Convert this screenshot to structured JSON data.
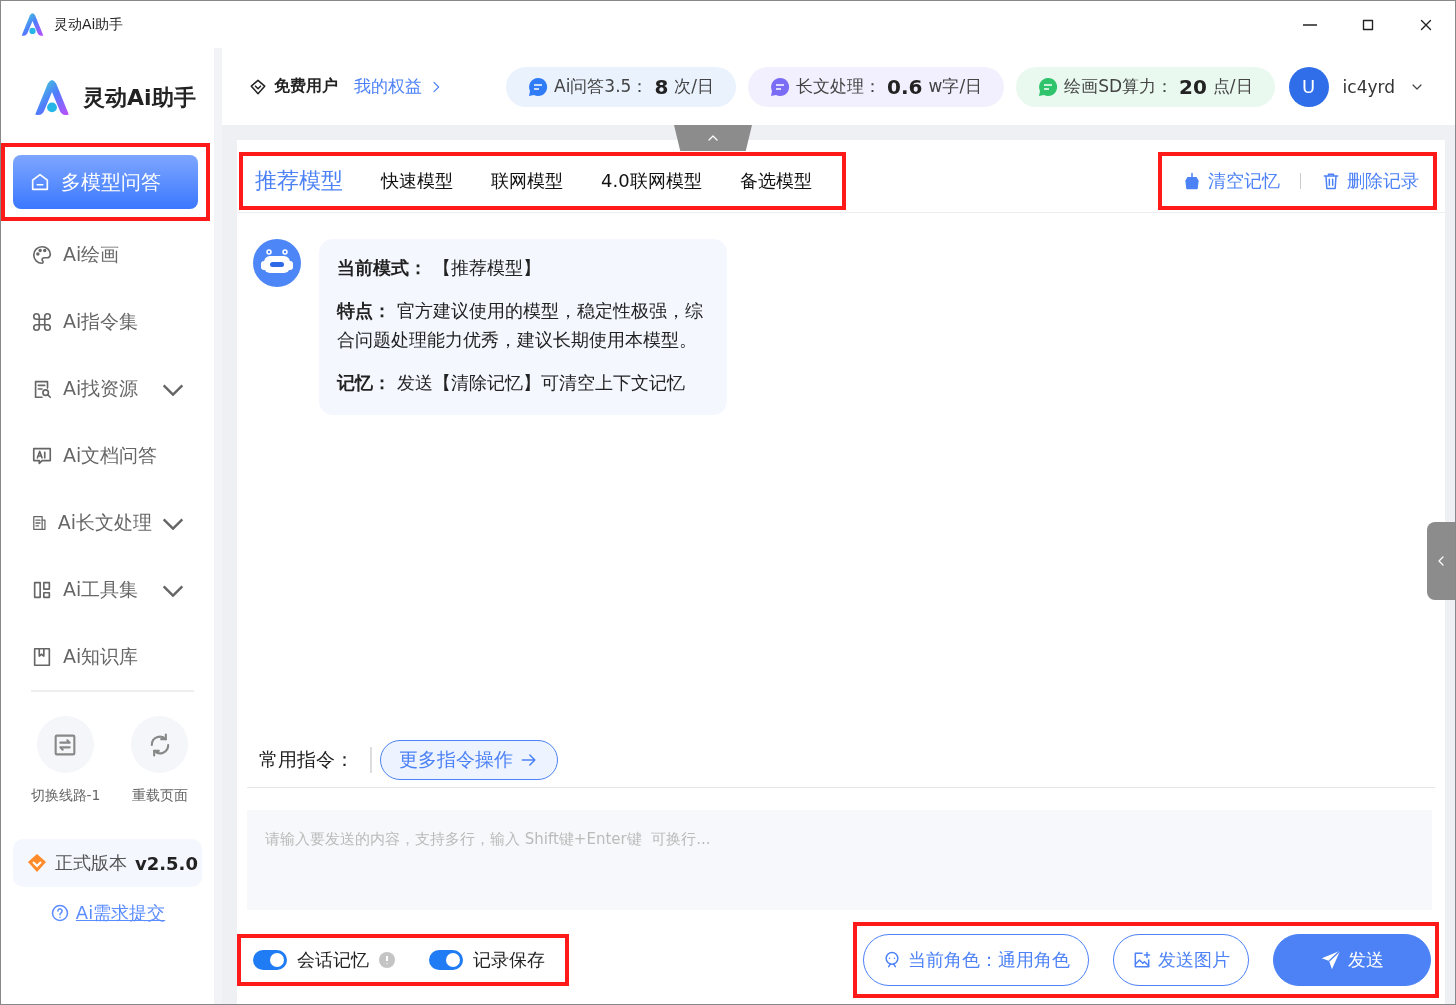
{
  "window": {
    "title": "灵动Ai助手"
  },
  "sidebar": {
    "brand": "灵动Ai助手",
    "items": [
      {
        "label": "多模型问答",
        "selected": true,
        "expandable": false
      },
      {
        "label": "Ai绘画",
        "selected": false,
        "expandable": false
      },
      {
        "label": "Ai指令集",
        "selected": false,
        "expandable": false
      },
      {
        "label": "Ai找资源",
        "selected": false,
        "expandable": true
      },
      {
        "label": "Ai文档问答",
        "selected": false,
        "expandable": false
      },
      {
        "label": "Ai长文处理",
        "selected": false,
        "expandable": true
      },
      {
        "label": "Ai工具集",
        "selected": false,
        "expandable": true
      },
      {
        "label": "Ai知识库",
        "selected": false,
        "expandable": false
      }
    ],
    "actions": [
      {
        "label": "切换线路-1"
      },
      {
        "label": "重载页面"
      }
    ],
    "version": {
      "label": "正式版本",
      "number": "v2.5.0"
    },
    "link": "Ai需求提交"
  },
  "header": {
    "user_type": "免费用户",
    "benefits_link": "我的权益",
    "quotas": [
      {
        "label": "Ai问答3.5：",
        "value": "8",
        "unit": "次/日",
        "color": "#2f7cf6"
      },
      {
        "label": "长文处理：",
        "value": "0.6",
        "unit": "w字/日",
        "color": "#7b6cf6"
      },
      {
        "label": "绘画SD算力：",
        "value": "20",
        "unit": "点/日",
        "color": "#2fc46b"
      }
    ],
    "user": {
      "initial": "U",
      "name": "ic4yrd"
    }
  },
  "tabs": [
    {
      "label": "推荐模型",
      "selected": true
    },
    {
      "label": "快速模型",
      "selected": false
    },
    {
      "label": "联网模型",
      "selected": false
    },
    {
      "label": "4.0联网模型",
      "selected": false
    },
    {
      "label": "备选模型",
      "selected": false
    }
  ],
  "actions": [
    {
      "label": "清空记忆"
    },
    {
      "label": "删除记录"
    }
  ],
  "message": {
    "lines": [
      "**当前模式：** 【推荐模型】",
      "**特点：** 官方建议使用的模型，稳定性极强，综合问题处理能力优秀，建议长期使用本模型。",
      "**记忆：** 发送【清除记忆】可清空上下文记忆"
    ]
  },
  "commands": {
    "label": "常用指令：",
    "button": "更多指令操作"
  },
  "input": {
    "placeholder": "请输入要发送的内容，支持多行，输入 Shift键+Enter键  可换行..."
  },
  "toggles": [
    {
      "label": "会话记忆",
      "on": true,
      "info": true
    },
    {
      "label": "记录保存",
      "on": true,
      "info": false
    }
  ],
  "buttons": [
    {
      "label": "当前角色：通用角色",
      "kind": "role"
    },
    {
      "label": "发送图片",
      "kind": "image"
    },
    {
      "label": "发送",
      "kind": "send"
    }
  ]
}
